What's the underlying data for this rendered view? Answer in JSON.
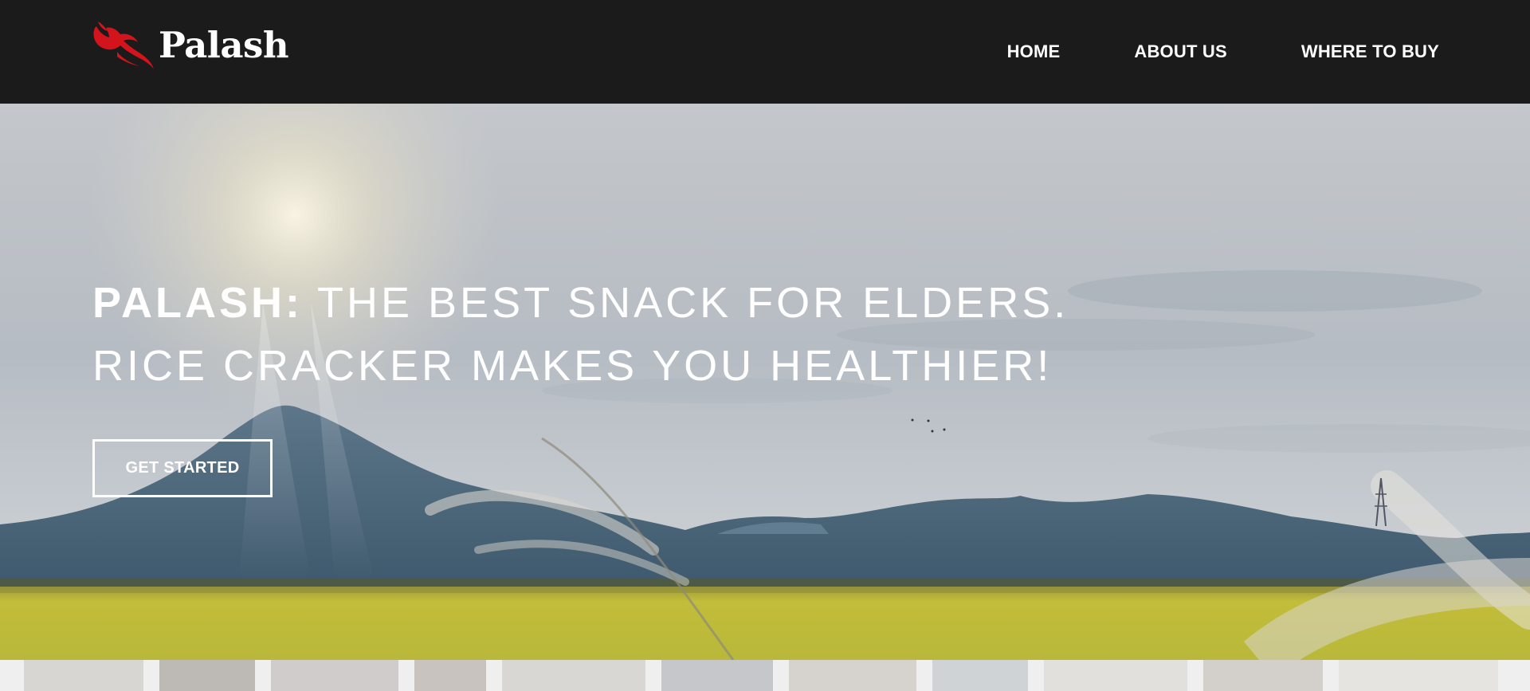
{
  "header": {
    "brand_name": "Palash",
    "logo_icon": "red-bird-logo-icon",
    "nav": [
      {
        "label": "HOME"
      },
      {
        "label": "ABOUT US"
      },
      {
        "label": "WHERE TO BUY"
      }
    ]
  },
  "hero": {
    "headline_brand": "PALASH:",
    "headline_rest": " THE BEST SNACK FOR ELDERS.",
    "headline_line2": "RICE CRACKER MAKES YOU HEALTHIER!",
    "cta_label": "GET STARTED",
    "background": "mountain-rice-field-photo"
  },
  "colors": {
    "navbar_bg": "#1b1b1b",
    "logo_red": "#d4141c",
    "text_white": "#ffffff"
  }
}
